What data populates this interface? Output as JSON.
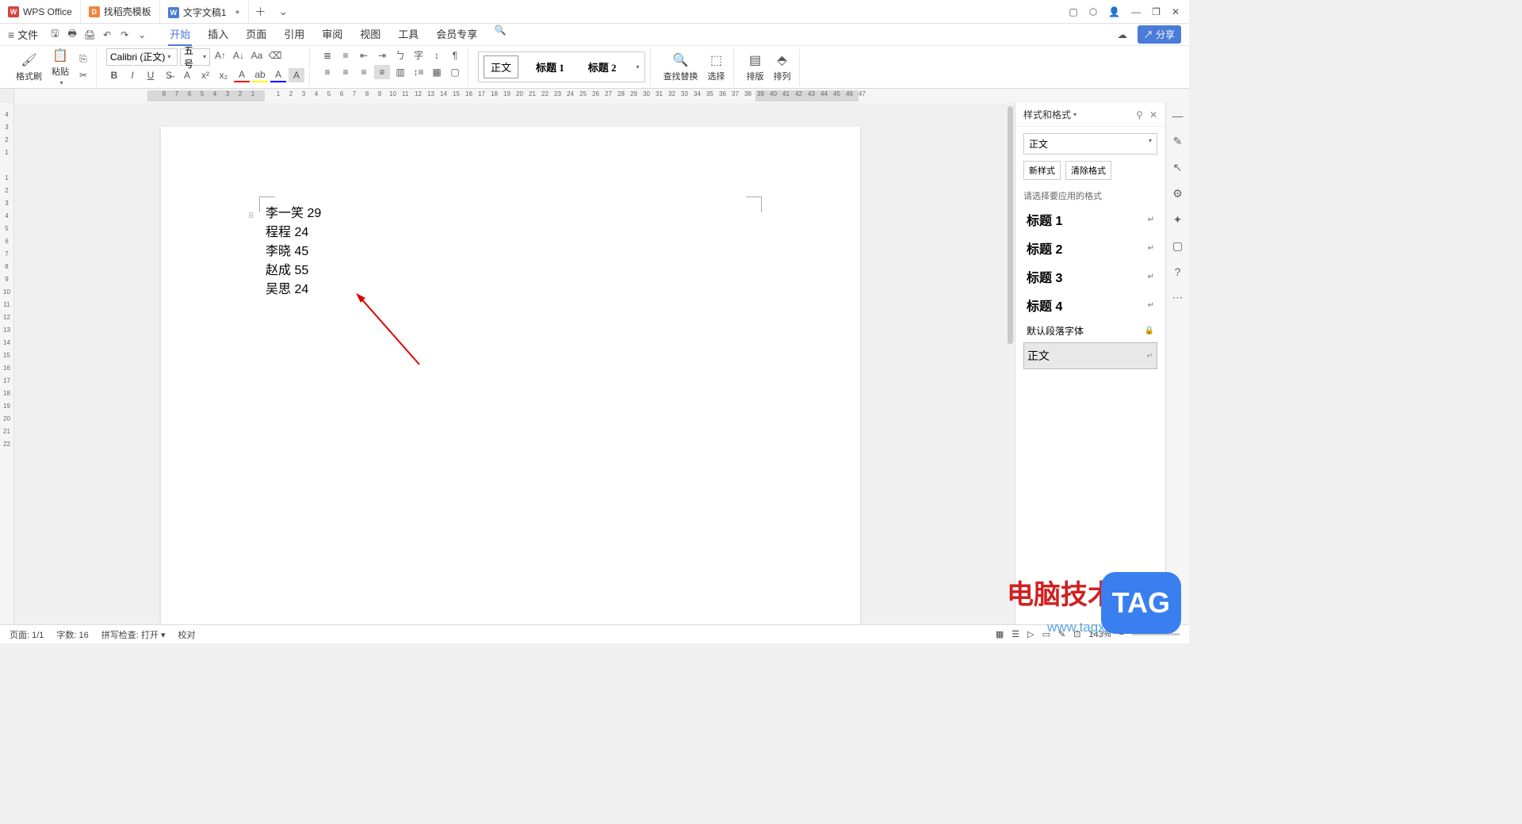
{
  "tabs": [
    {
      "label": "WPS Office",
      "icon": "W"
    },
    {
      "label": "找稻壳模板",
      "icon": "D"
    },
    {
      "label": "文字文稿1",
      "icon": "W",
      "dirty": "●"
    }
  ],
  "menu": {
    "file": "文件",
    "items": [
      "开始",
      "插入",
      "页面",
      "引用",
      "审阅",
      "视图",
      "工具",
      "会员专享"
    ],
    "share": "分享"
  },
  "ribbon": {
    "format_brush": "格式刷",
    "paste": "粘贴",
    "font_name": "Calibri (正文)",
    "font_size": "五号",
    "styles": {
      "normal": "正文",
      "h1": "标题 1",
      "h2": "标题 2"
    },
    "find_replace": "查找替换",
    "select": "选择",
    "layout": "排版",
    "arrange": "排列"
  },
  "ruler_nums": [
    "8",
    "7",
    "6",
    "5",
    "4",
    "3",
    "2",
    "1",
    "",
    "1",
    "2",
    "3",
    "4",
    "5",
    "6",
    "7",
    "8",
    "9",
    "10",
    "11",
    "12",
    "13",
    "14",
    "15",
    "16",
    "17",
    "18",
    "19",
    "20",
    "21",
    "22",
    "23",
    "24",
    "25",
    "26",
    "27",
    "28",
    "29",
    "30",
    "31",
    "32",
    "33",
    "34",
    "35",
    "36",
    "37",
    "38",
    "39",
    "40",
    "41",
    "42",
    "43",
    "44",
    "45",
    "46",
    "47"
  ],
  "ruler_v": [
    "4",
    "3",
    "2",
    "1",
    "",
    "1",
    "2",
    "3",
    "4",
    "5",
    "6",
    "7",
    "8",
    "9",
    "10",
    "11",
    "12",
    "13",
    "14",
    "15",
    "16",
    "17",
    "18",
    "19",
    "20",
    "21",
    "22"
  ],
  "document": {
    "lines": [
      {
        "name": "李一笑",
        "val": "29",
        "pad": " "
      },
      {
        "name": "程程",
        "val": "24",
        "pad": " "
      },
      {
        "name": "李晓",
        "val": "45",
        "pad": "     "
      },
      {
        "name": "赵成",
        "val": "55",
        "pad": " "
      },
      {
        "name": "吴思",
        "val": "24",
        "pad": "    "
      }
    ]
  },
  "sidepanel": {
    "title": "样式和格式",
    "current": "正文",
    "new_style": "新样式",
    "clear_fmt": "清除格式",
    "choose_label": "请选择要应用的格式",
    "items": [
      {
        "label": "标题 1",
        "h": true
      },
      {
        "label": "标题 2",
        "h": true
      },
      {
        "label": "标题 3",
        "h": true
      },
      {
        "label": "标题 4",
        "h": true
      },
      {
        "label": "默认段落字体",
        "small": true,
        "lock": true
      },
      {
        "label": "正文",
        "sel": true
      }
    ]
  },
  "status": {
    "page": "页面: 1/1",
    "words": "字数: 16",
    "spell": "拼写检查: 打开",
    "proof": "校对",
    "zoom": "143%"
  },
  "watermark": {
    "line1": "电脑技术网",
    "line2": "www.tagxp.com",
    "badge": "TAG"
  }
}
